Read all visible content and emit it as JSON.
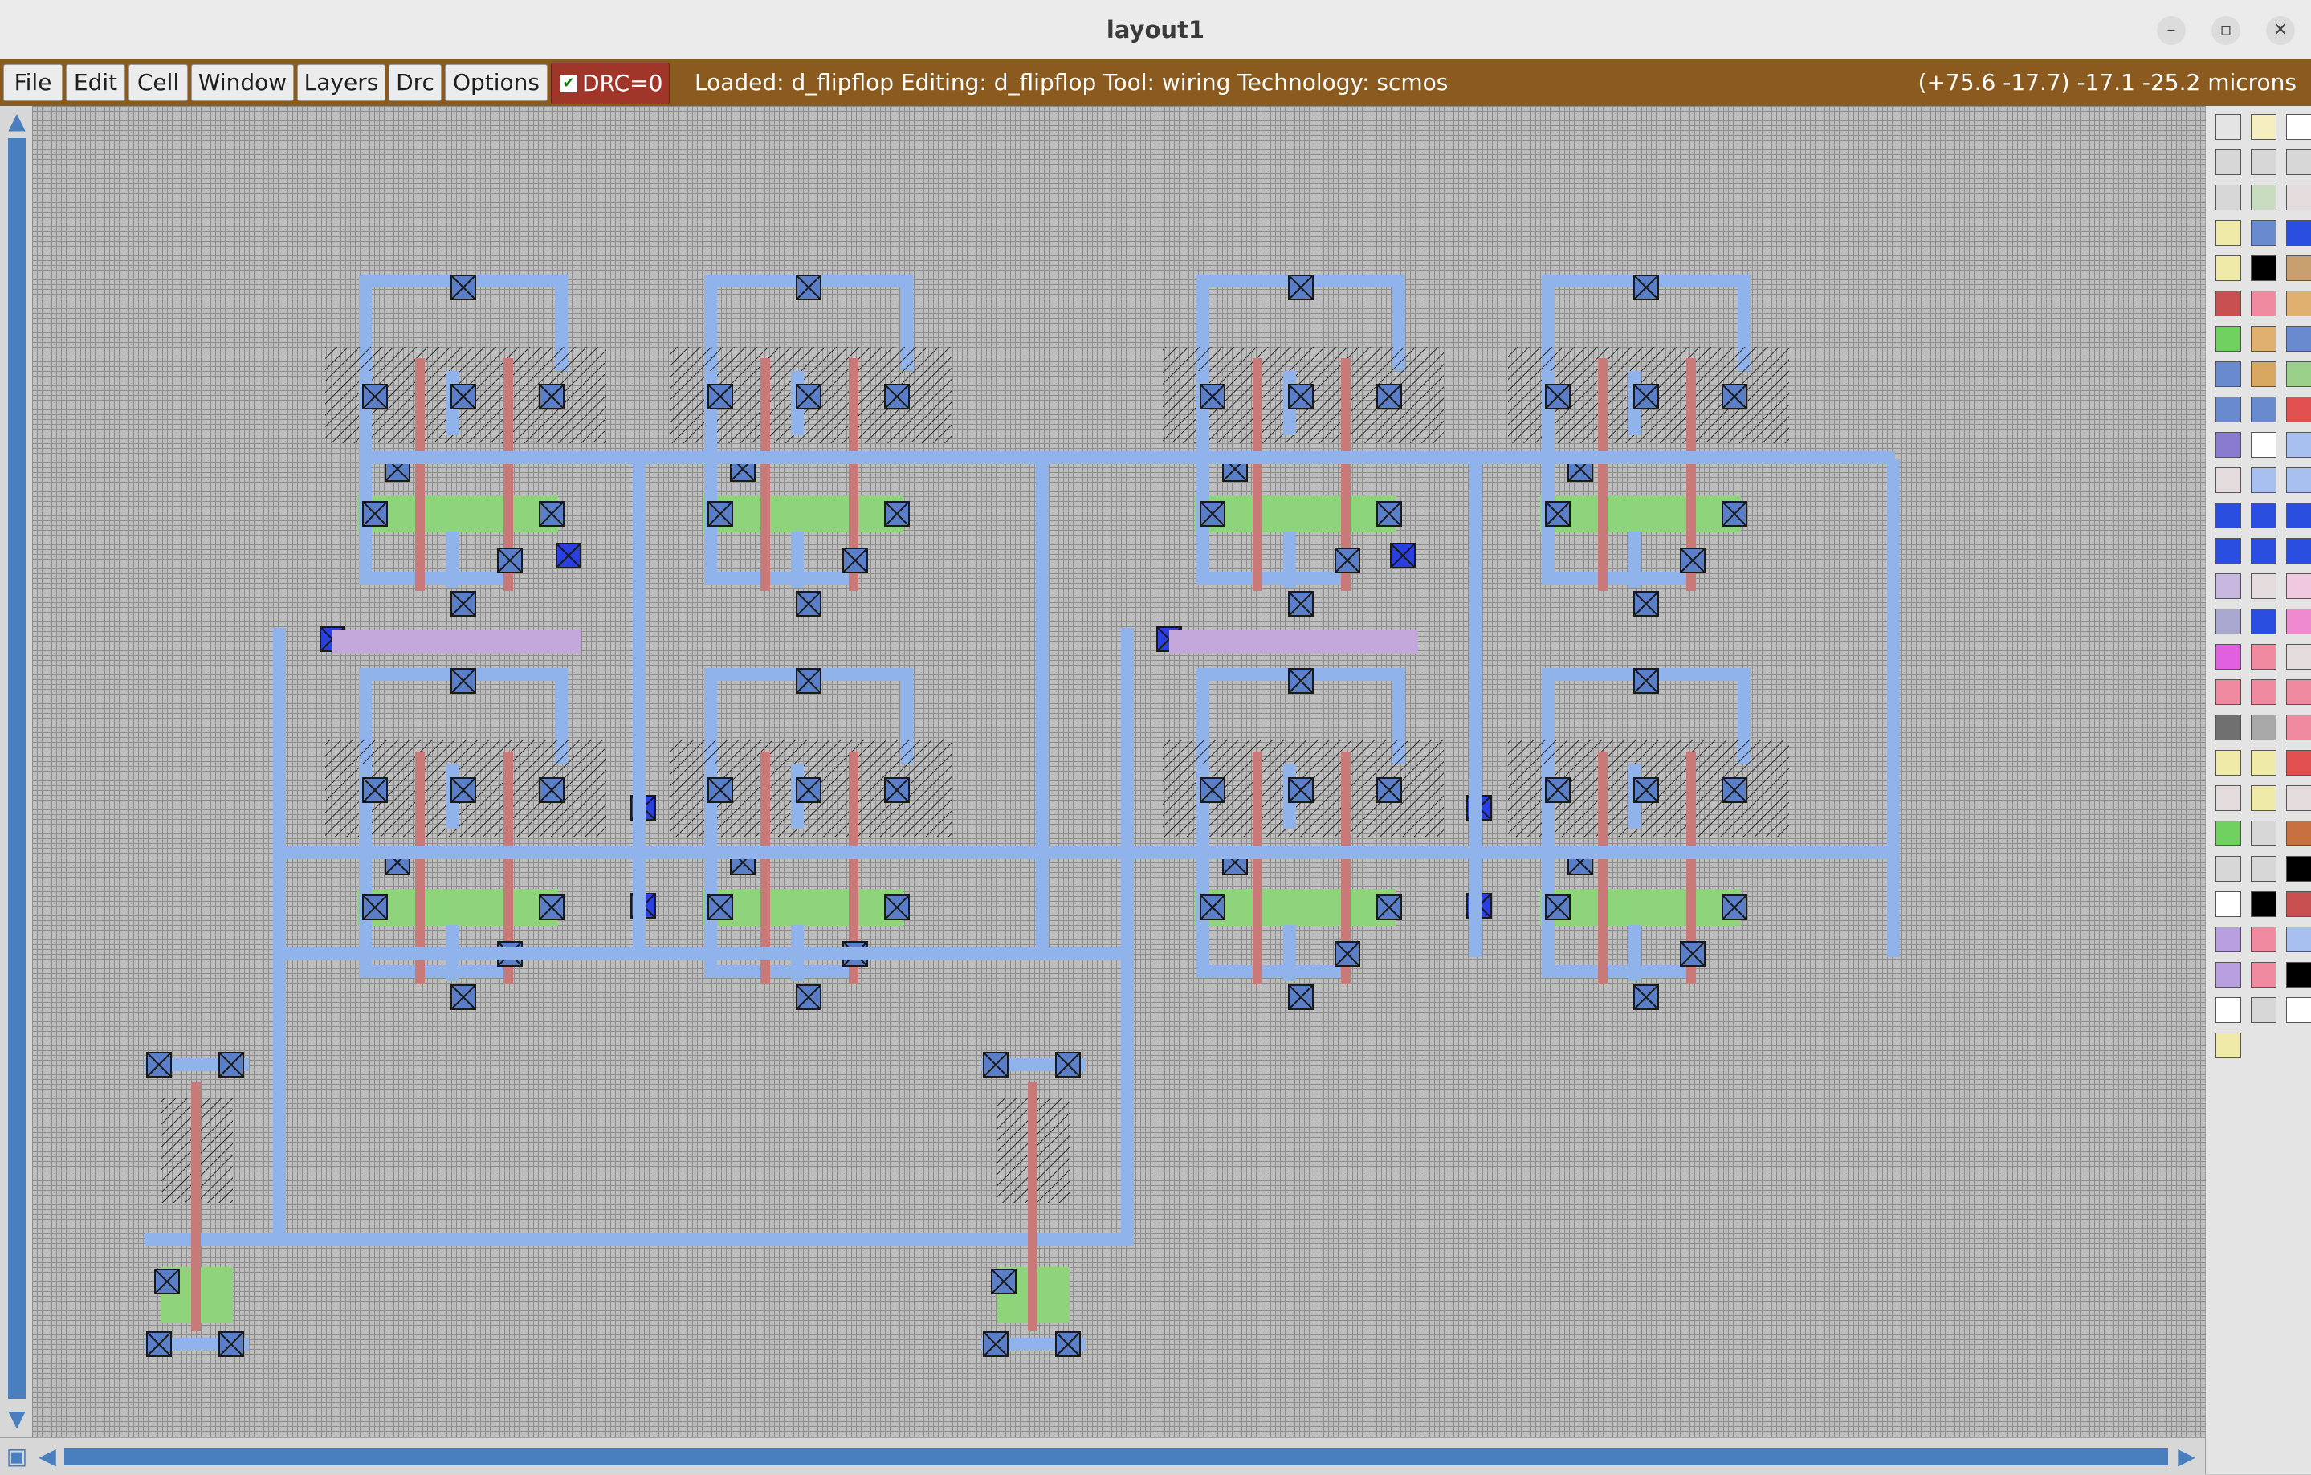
{
  "window": {
    "title": "layout1",
    "controls": {
      "minimize": "–",
      "maximize": "▫",
      "close": "✕"
    }
  },
  "menu": {
    "items": [
      {
        "id": "file",
        "label": "File"
      },
      {
        "id": "edit",
        "label": "Edit"
      },
      {
        "id": "cell",
        "label": "Cell"
      },
      {
        "id": "window",
        "label": "Window"
      },
      {
        "id": "layers",
        "label": "Layers"
      },
      {
        "id": "drc",
        "label": "Drc"
      },
      {
        "id": "options",
        "label": "Options"
      }
    ],
    "drc_toggle": {
      "label": "DRC=0",
      "checked": true
    }
  },
  "status": {
    "text": "Loaded: d_flipflop Editing: d_flipflop Tool: wiring  Technology: scmos",
    "coords": "(+75.6 -17.7) -17.1 -25.2 microns"
  },
  "colors": {
    "menubar": "#8b5a1e",
    "drc": "#a0352a",
    "metal1": "#8fb3ea",
    "poly": "#c97a78",
    "diffusion": "#8ed47a",
    "well_hatch": "#2a2a2a",
    "metal2_purple": "#c4a8dc",
    "contact": "#5a7fc8",
    "via": "#2a3fe0",
    "scroll": "#4a7fbf"
  },
  "palette": {
    "swatches": [
      "#e4e4e4",
      "#f5eec0",
      "#ffffff",
      "#d7d7d7",
      "#d7d7d7",
      "#d7d7d7",
      "#d7d7d7",
      "#c8dcc0",
      "#e4dcdc",
      "#f0eaa8",
      "#6a8ad0",
      "#2a4fe0",
      "#f0eaa8",
      "#000000",
      "#c8a070",
      "#c85050",
      "#f08aa0",
      "#e0b070",
      "#70d060",
      "#e0b070",
      "#6a8ad0",
      "#6a8ad0",
      "#d8a860",
      "#9ad08a",
      "#6a8ad0",
      "#6a8ad0",
      "#e05050",
      "#8a7ad0",
      "#ffffff",
      "#a8c0f0",
      "#e4dcdc",
      "#a8c0f0",
      "#a8c0f0",
      "#2a4fe0",
      "#2a4fe0",
      "#2a4fe0",
      "#2a4fe0",
      "#2a4fe0",
      "#2a4fe0",
      "#c8b8e0",
      "#e4dcdc",
      "#f0c8e0",
      "#a8a8d0",
      "#2a4fe0",
      "#f08ad0",
      "#e060e0",
      "#f08aa0",
      "#e4dcdc",
      "#f08aa0",
      "#f08aa0",
      "#f08aa0",
      "#707070",
      "#a8a8a8",
      "#f08aa0",
      "#f0eaa8",
      "#f0eaa8",
      "#e05050",
      "#e4dcdc",
      "#f0eaa8",
      "#e4dcdc",
      "#70d060",
      "#d7d7d7",
      "#c87040",
      "#d7d7d7",
      "#d7d7d7",
      "#000000",
      "#ffffff",
      "#000000",
      "#c85050",
      "#b8a0e0",
      "#f08aa0",
      "#a8c0f0",
      "#b8a0e0",
      "#f08aa0",
      "#000000",
      "#ffffff",
      "#d7d7d7",
      "#ffffff",
      "#f0eaa8"
    ]
  }
}
